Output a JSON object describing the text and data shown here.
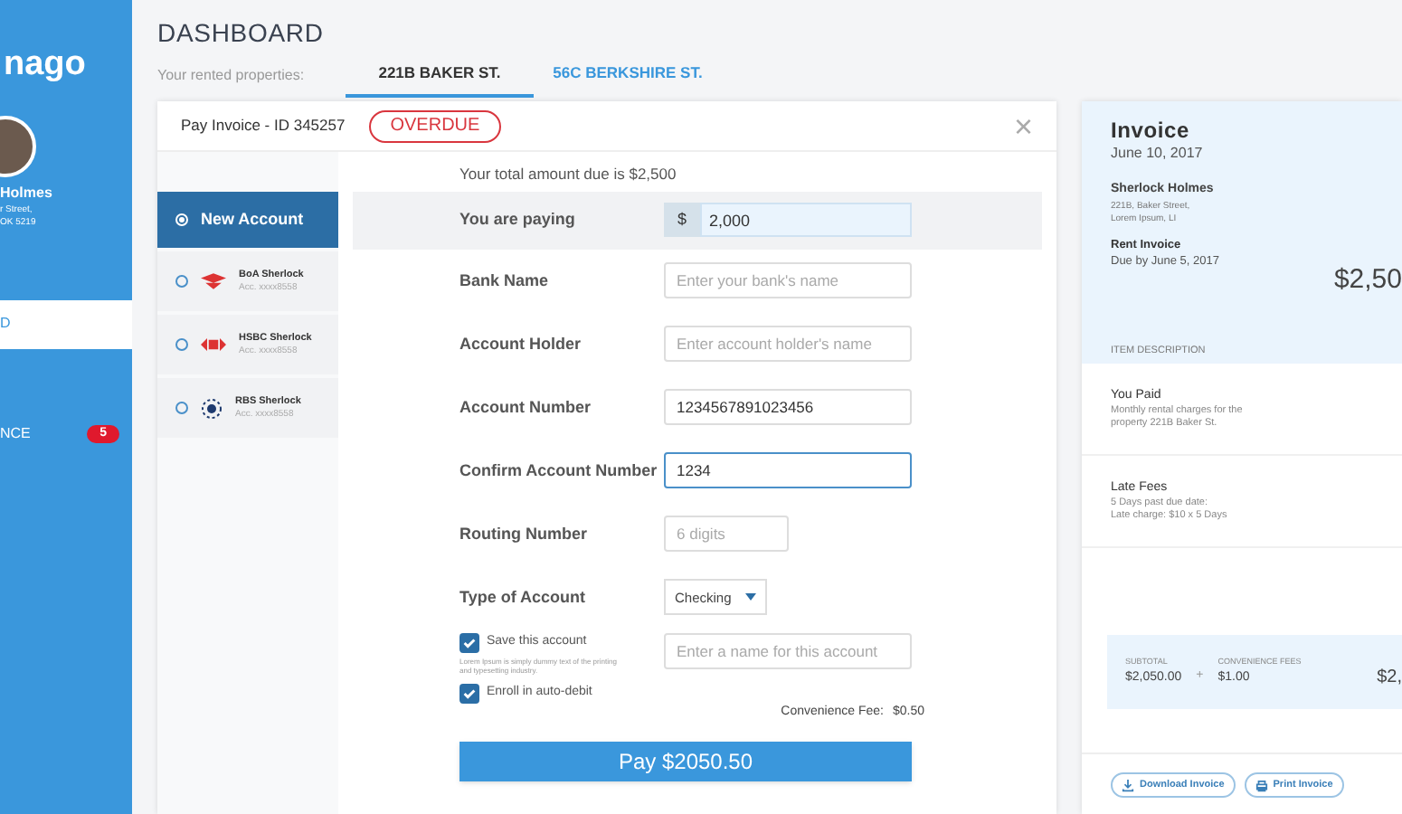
{
  "sidebar": {
    "logo": "nago",
    "user": {
      "name": "Holmes",
      "address": [
        "r Street,",
        "OK 5219"
      ]
    },
    "items": [
      {
        "label": "D",
        "selected": true
      },
      {
        "label": "NCE",
        "selected": false,
        "badge": "5"
      }
    ]
  },
  "header": {
    "title": "DASHBOARD",
    "properties_label": "Your rented properties:",
    "tabs": [
      {
        "label": "221B BAKER ST.",
        "selected": true
      },
      {
        "label": "56C BERKSHIRE ST.",
        "selected": false
      }
    ]
  },
  "modal": {
    "title": "Pay Invoice - ID 345257",
    "status": "OVERDUE",
    "close": "×",
    "accounts": [
      {
        "name": "New Account",
        "selected": true,
        "kind": "new"
      },
      {
        "name": "BoA Sherlock",
        "number": "Acc. xxxx8558",
        "selected": false,
        "kind": "boa"
      },
      {
        "name": "HSBC Sherlock",
        "number": "Acc. xxxx8558",
        "selected": false,
        "kind": "hsbc"
      },
      {
        "name": "RBS Sherlock",
        "number": "Acc. xxxx8558",
        "selected": false,
        "kind": "rbs"
      }
    ],
    "total_due": "Your total amount due is $2,500",
    "fields": [
      {
        "kind": "amount",
        "label": "You are paying",
        "currency": "$",
        "value": "2,000"
      },
      {
        "kind": "text",
        "label": "Bank Name",
        "placeholder": "Enter your bank's name",
        "focused": false
      },
      {
        "kind": "text",
        "label": "Account Holder",
        "placeholder": "Enter account holder's name",
        "focused": false
      },
      {
        "kind": "text",
        "label": "Account Number",
        "value": "1234567891023456",
        "focused": false
      },
      {
        "kind": "text",
        "label": "Confirm Account Number",
        "value": "1234",
        "focused": true
      },
      {
        "kind": "short",
        "label": "Routing Number",
        "placeholder": "6 digits",
        "focused": false
      },
      {
        "kind": "select",
        "label": "Type of Account",
        "value": "Checking"
      }
    ],
    "save_account": {
      "label": "Save this account",
      "checked": true,
      "note": "Lorem Ipsum is simply dummy text of the printing and typesetting industry.",
      "name_placeholder": "Enter a name for this account"
    },
    "auto_debit": {
      "label": "Enroll in auto-debit",
      "checked": true
    },
    "fee_label": "Convenience Fee:",
    "fee_value": "$0.50",
    "pay_button": "Pay $2050.50"
  },
  "invoice": {
    "title": "Invoice",
    "date": "June 10, 2017",
    "name": "Sherlock Holmes",
    "address": [
      "221B, Baker Street,",
      "Lorem Ipsum, LI"
    ],
    "type": "Rent Invoice",
    "due": "Due by June 5, 2017",
    "amount": "$2,50",
    "items_header": "ITEM DESCRIPTION",
    "items": [
      {
        "title": "You Paid",
        "desc": [
          "Monthly rental charges for the",
          "property 221B Baker St."
        ]
      },
      {
        "title": "Late Fees",
        "desc": [
          "5 Days past due date:",
          "Late charge: $10 x 5 Days"
        ]
      }
    ],
    "subtotal_label": "SUBTOTAL",
    "subtotal": "$2,050.00",
    "plus": "+",
    "fees_label": "CONVENIENCE FEES",
    "fees": "$1.00",
    "total": "$2,",
    "buttons": [
      {
        "label": "Download Invoice",
        "kind": "download"
      },
      {
        "label": "Print Invoice",
        "kind": "print"
      }
    ]
  }
}
